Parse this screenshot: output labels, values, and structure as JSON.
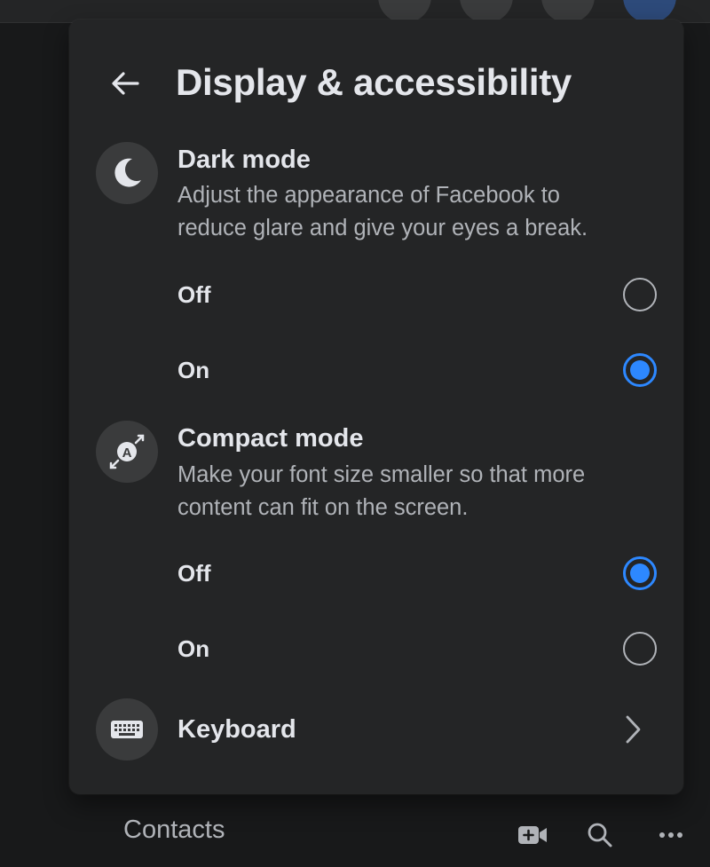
{
  "panel": {
    "title": "Display & accessibility",
    "back_icon": "arrow-left-icon"
  },
  "dark_mode": {
    "icon": "moon-icon",
    "title": "Dark mode",
    "description_line1": "Adjust the appearance of Facebook to",
    "description_line2": "reduce glare and give your eyes a break.",
    "options": [
      {
        "label": "Off",
        "selected": false
      },
      {
        "label": "On",
        "selected": true
      }
    ]
  },
  "compact_mode": {
    "icon": "font-size-icon",
    "title": "Compact mode",
    "description_line1": "Make your font size smaller so that more",
    "description_line2": "content can fit on the screen.",
    "options": [
      {
        "label": "Off",
        "selected": true
      },
      {
        "label": "On",
        "selected": false
      }
    ]
  },
  "keyboard": {
    "icon": "keyboard-icon",
    "label": "Keyboard",
    "chevron_icon": "chevron-right-icon"
  },
  "contacts": {
    "title": "Contacts",
    "icons": [
      "video-plus-icon",
      "search-icon",
      "more-icon"
    ]
  },
  "colors": {
    "accent": "#2d88ff",
    "panel_bg": "#242526",
    "page_bg": "#18191a",
    "primary_text": "#e4e6eb",
    "secondary_text": "#b0b3b8"
  }
}
